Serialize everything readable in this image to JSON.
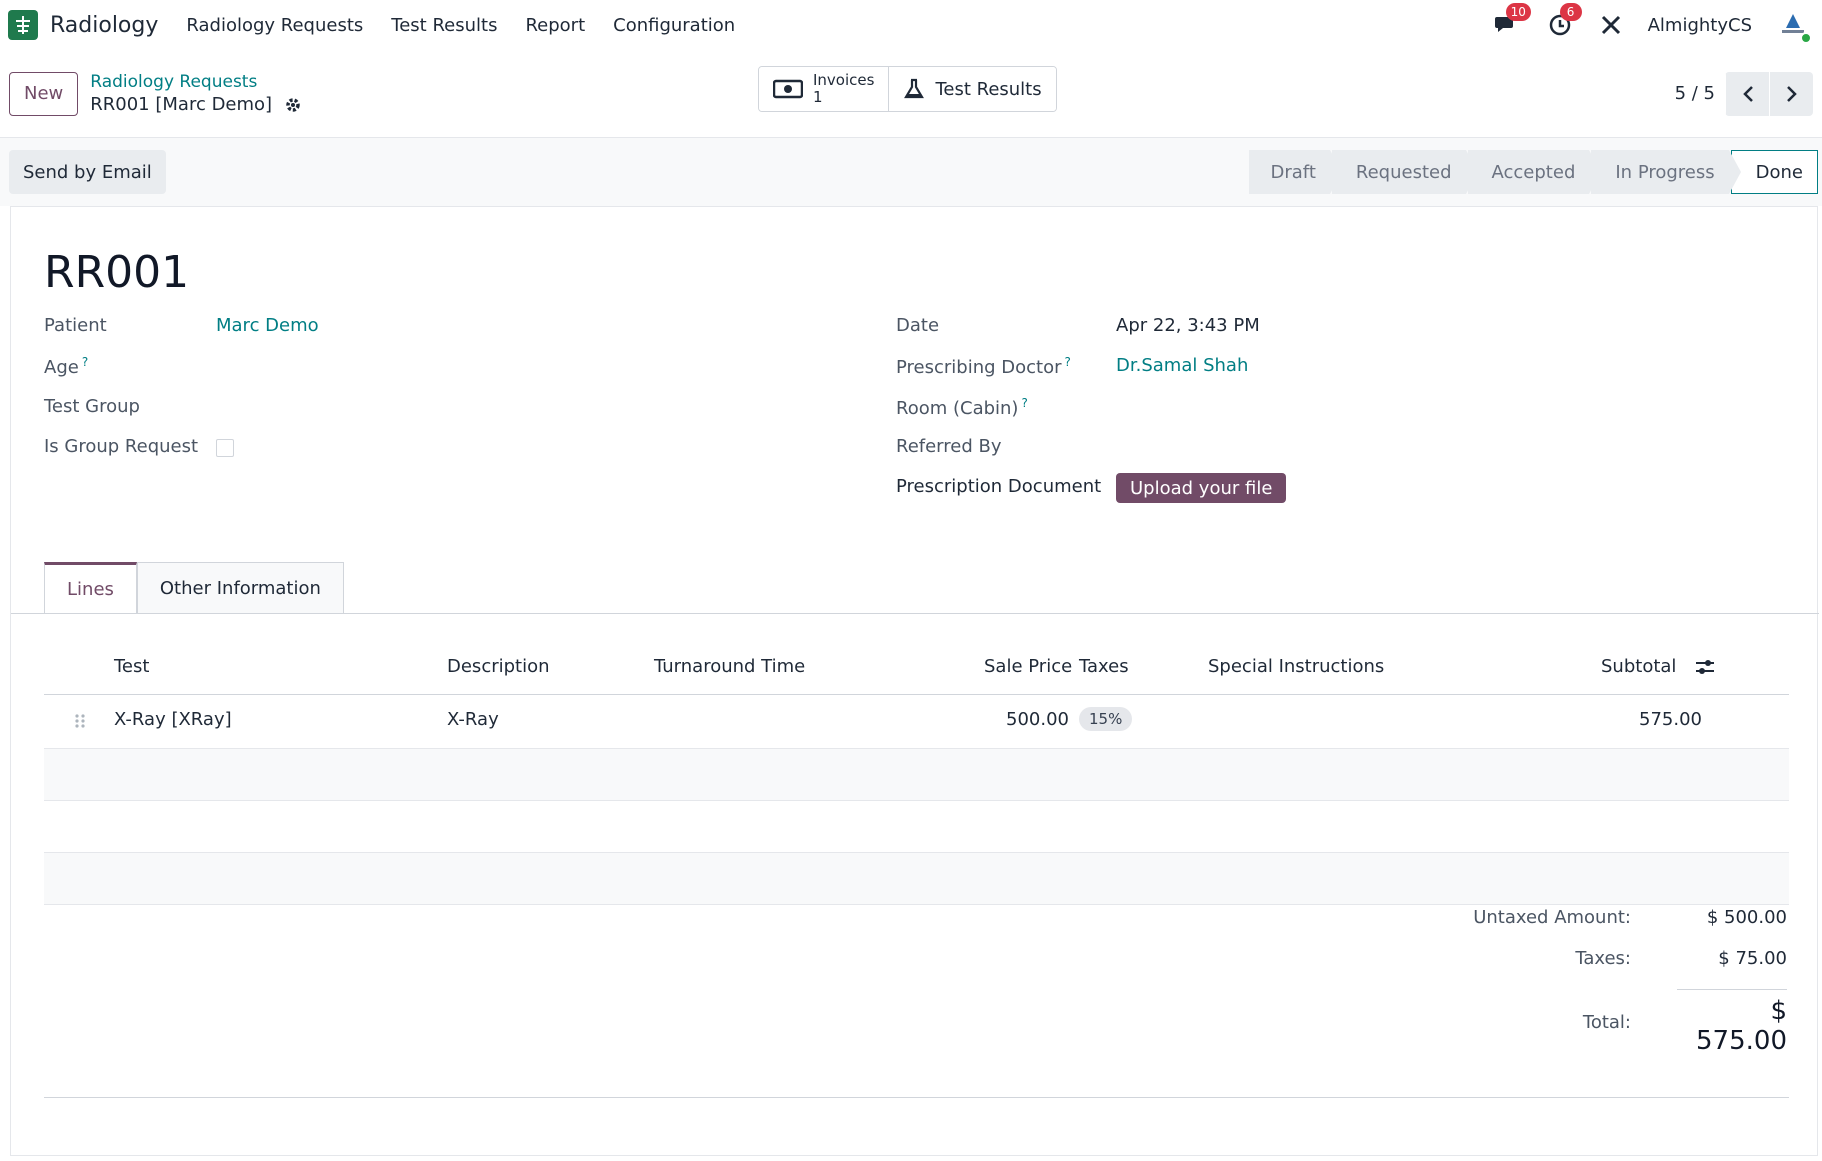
{
  "app": {
    "name": "Radiology",
    "accent": "#714b67",
    "link_color": "#017e84"
  },
  "menu": [
    "Radiology Requests",
    "Test Results",
    "Report",
    "Configuration"
  ],
  "systray": {
    "messages_count": "10",
    "activities_count": "6",
    "company": "AlmightyCS"
  },
  "control": {
    "new_label": "New",
    "breadcrumb_parent": "Radiology Requests",
    "breadcrumb_current": "RR001 [Marc Demo]",
    "invoices_label": "Invoices",
    "invoices_count": "1",
    "test_results_label": "Test Results",
    "pager": "5 / 5"
  },
  "actions": {
    "send_email": "Send by Email",
    "stages": [
      "Draft",
      "Requested",
      "Accepted",
      "In Progress",
      "Done"
    ],
    "active_stage": "Done"
  },
  "record": {
    "name": "RR001",
    "left": {
      "patient_label": "Patient",
      "patient_value": "Marc Demo",
      "age_label": "Age",
      "test_group_label": "Test Group",
      "group_request_label": "Is Group Request"
    },
    "right": {
      "date_label": "Date",
      "date_value": "Apr 22, 3:43 PM",
      "doctor_label": "Prescribing Doctor",
      "doctor_value": "Dr.Samal Shah",
      "room_label": "Room (Cabin)",
      "referred_label": "Referred By",
      "prescription_label": "Prescription Document",
      "upload_label": "Upload your file"
    }
  },
  "tabs": [
    "Lines",
    "Other Information"
  ],
  "lines": {
    "headers": [
      "Test",
      "Description",
      "Turnaround Time",
      "Sale Price",
      "Taxes",
      "Special Instructions",
      "Subtotal"
    ],
    "rows": [
      {
        "test": "X-Ray [XRay]",
        "description": "X-Ray",
        "turnaround": "",
        "price": "500.00",
        "taxes": "15%",
        "instructions": "",
        "subtotal": "575.00"
      }
    ]
  },
  "totals": {
    "untaxed_label": "Untaxed Amount:",
    "untaxed_value": "$ 500.00",
    "taxes_label": "Taxes:",
    "taxes_value": "$ 75.00",
    "total_label": "Total:",
    "total_value": "$ 575.00"
  }
}
